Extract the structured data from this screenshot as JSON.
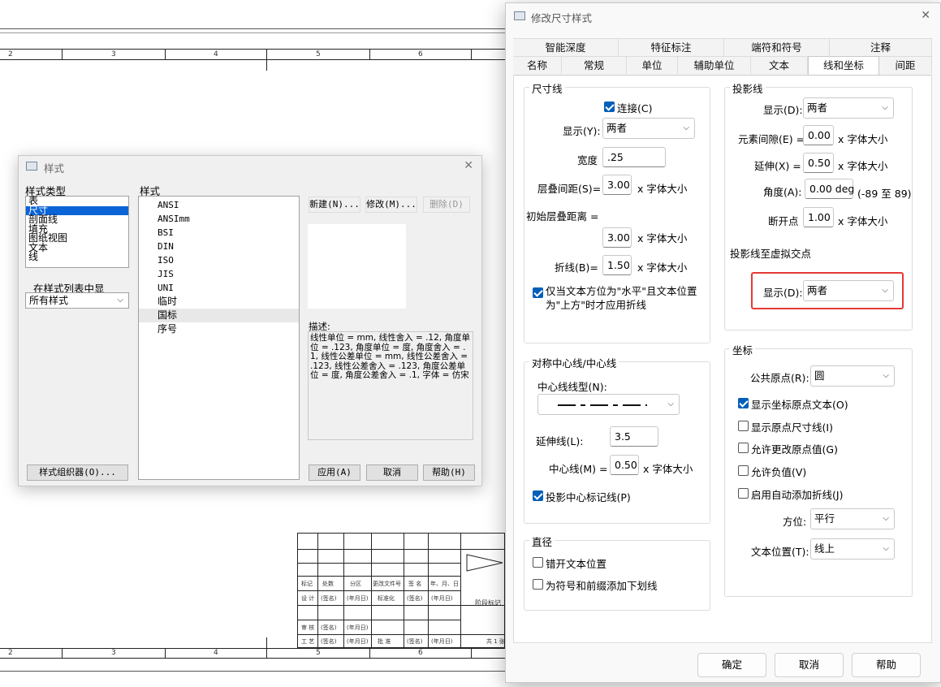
{
  "drawing": {
    "ruler_top": [
      "2",
      "3",
      "4",
      "5",
      "6"
    ],
    "ruler_bottom": [
      "2",
      "3",
      "4",
      "5",
      "6"
    ],
    "title_block": {
      "row_a": [
        "标记",
        "处数",
        "分区",
        "更改文件号",
        "签 名",
        "年、月、日"
      ],
      "row_b": [
        "设 计",
        "(签名)",
        "(年月日)",
        "标准化",
        "(签名)",
        "(年月日)"
      ],
      "row_c": [
        "审 核",
        "(签名)",
        "(年月日)"
      ],
      "row_d": [
        "工 艺",
        "(签名)",
        "(年月日)",
        "批 准",
        "(签名)",
        "(年月日)"
      ],
      "stage_label": "阶段标记",
      "sheet_label": "共 1 张"
    }
  },
  "style_dialog": {
    "title": "样式",
    "close": "✕",
    "style_type_label": "样式类型",
    "style_types": [
      "表",
      "尺寸",
      "剖面线",
      "填充",
      "图纸视图",
      "文本",
      "线"
    ],
    "selected_type": "尺寸",
    "filter_label": "在样式列表中显",
    "filter_value": "所有样式",
    "organizer_button": "样式组织器(O)...",
    "style_label": "样式",
    "styles": [
      "ANSI",
      "ANSImm",
      "BSI",
      "DIN",
      "ISO",
      "JIS",
      "UNI",
      "临时",
      "国标",
      "序号"
    ],
    "selected_style": "国标",
    "new_button": "新建(N)...",
    "modify_button": "修改(M)...",
    "delete_button": "删除(D)",
    "desc_label": "描述:",
    "description": "线性单位 = mm, 线性舍入 = .12, 角度单位 = .123, 角度单位 = 度, 角度舍入 = .1, 线性公差单位 = mm, 线性公差舍入 = .123, 线性公差舍入 = .123, 角度公差单位 = 度, 角度公差舍入 = .1, 字体 = 仿宋",
    "apply_button": "应用(A)",
    "cancel_button": "取消",
    "help_button": "帮助(H)"
  },
  "modify_dialog": {
    "title": "修改尺寸样式",
    "close": "✕",
    "tabs_row1": [
      "智能深度",
      "特征标注",
      "端符和符号",
      "注释"
    ],
    "tabs_row2": [
      "名称",
      "常规",
      "单位",
      "辅助单位",
      "文本",
      "线和坐标",
      "间距"
    ],
    "active_tab": "线和坐标",
    "dim_line": {
      "title": "尺寸线",
      "connect_label": "连接(C)",
      "connect_checked": true,
      "display_label": "显示(Y):",
      "display_value": "两者",
      "width_label": "宽度",
      "width_value": ".25",
      "stack_label": "层叠间距(S)=",
      "stack_value": "3.00",
      "unit_text": "x 字体大小",
      "initial_label": "初始层叠距离 =",
      "initial_value": "3.00",
      "fold_label": "折线(B)=",
      "fold_value": "1.50",
      "only_when_label": "仅当文本方位为\"水平\"且文本位置为\"上方\"时才应用折线",
      "only_when_checked": true
    },
    "projection": {
      "title": "投影线",
      "display_label": "显示(D):",
      "display_value": "两者",
      "gap_label": "元素间隙(E) =",
      "gap_value": "0.00",
      "extend_label": "延伸(X) =",
      "extend_value": "0.50",
      "angle_label": "角度(A):",
      "angle_value": "0.00 deg",
      "angle_range": "(-89 至 89)",
      "break_label": "断开点",
      "break_value": "1.00",
      "unit_text": "x 字体大小",
      "virtual_label": "投影线至虚拟交点",
      "virtual_display_label": "显示(D):",
      "virtual_display_value": "两者",
      "highlight_color": "#e53935"
    },
    "center": {
      "title": "对称中心线/中心线",
      "linetype_label": "中心线线型(N):",
      "extend_label": "延伸线(L):",
      "extend_value": "3.5",
      "centerline_label": "中心线(M) =",
      "centerline_value": "0.50",
      "unit_text": "x 字体大小",
      "project_label": "投影中心标记线(P)",
      "project_checked": true
    },
    "diameter": {
      "title": "直径",
      "stagger_label": "错开文本位置",
      "stagger_checked": false,
      "underline_label": "为符号和前缀添加下划线",
      "underline_checked": false
    },
    "coords": {
      "title": "坐标",
      "origin_label": "公共原点(R):",
      "origin_value": "圆",
      "show_origin_text": "显示坐标原点文本(O)",
      "show_origin_text_checked": true,
      "show_origin_dim": "显示原点尺寸线(I)",
      "show_origin_dim_checked": false,
      "allow_change": "允许更改原点值(G)",
      "allow_change_checked": false,
      "allow_negative": "允许负值(V)",
      "allow_negative_checked": false,
      "auto_fold": "启用自动添加折线(J)",
      "auto_fold_checked": false,
      "orient_label": "方位:",
      "orient_value": "平行",
      "text_pos_label": "文本位置(T):",
      "text_pos_value": "线上"
    },
    "ok_button": "确定",
    "cancel_button": "取消",
    "help_button": "帮助"
  }
}
